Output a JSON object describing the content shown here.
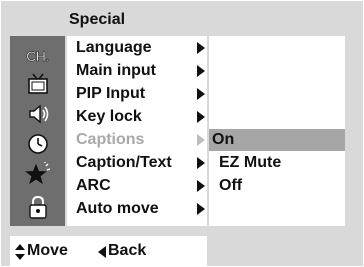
{
  "menu": {
    "title": "Special",
    "items": [
      {
        "label": "Language",
        "enabled": true
      },
      {
        "label": "Main input",
        "enabled": true
      },
      {
        "label": "PIP Input",
        "enabled": true
      },
      {
        "label": "Key lock",
        "enabled": true
      },
      {
        "label": "Captions",
        "enabled": false
      },
      {
        "label": "Caption/Text",
        "enabled": true
      },
      {
        "label": "ARC",
        "enabled": true
      },
      {
        "label": "Auto move",
        "enabled": true
      }
    ]
  },
  "submenu": {
    "options": [
      {
        "label": "On",
        "selected": true
      },
      {
        "label": "EZ Mute",
        "selected": false
      },
      {
        "label": "Off",
        "selected": false
      }
    ]
  },
  "icons": {
    "ch_text": "CH.",
    "names": [
      "channel-icon",
      "tv-icon",
      "speaker-icon",
      "clock-icon",
      "special-star-icon",
      "lock-icon"
    ]
  },
  "footer": {
    "move_label": "Move",
    "back_label": "Back"
  },
  "colors": {
    "background": "#d9d9d9",
    "icon_bar": "#6e6e6e",
    "highlight": "#a6a6a6",
    "disabled_text": "#a8a8a8"
  }
}
